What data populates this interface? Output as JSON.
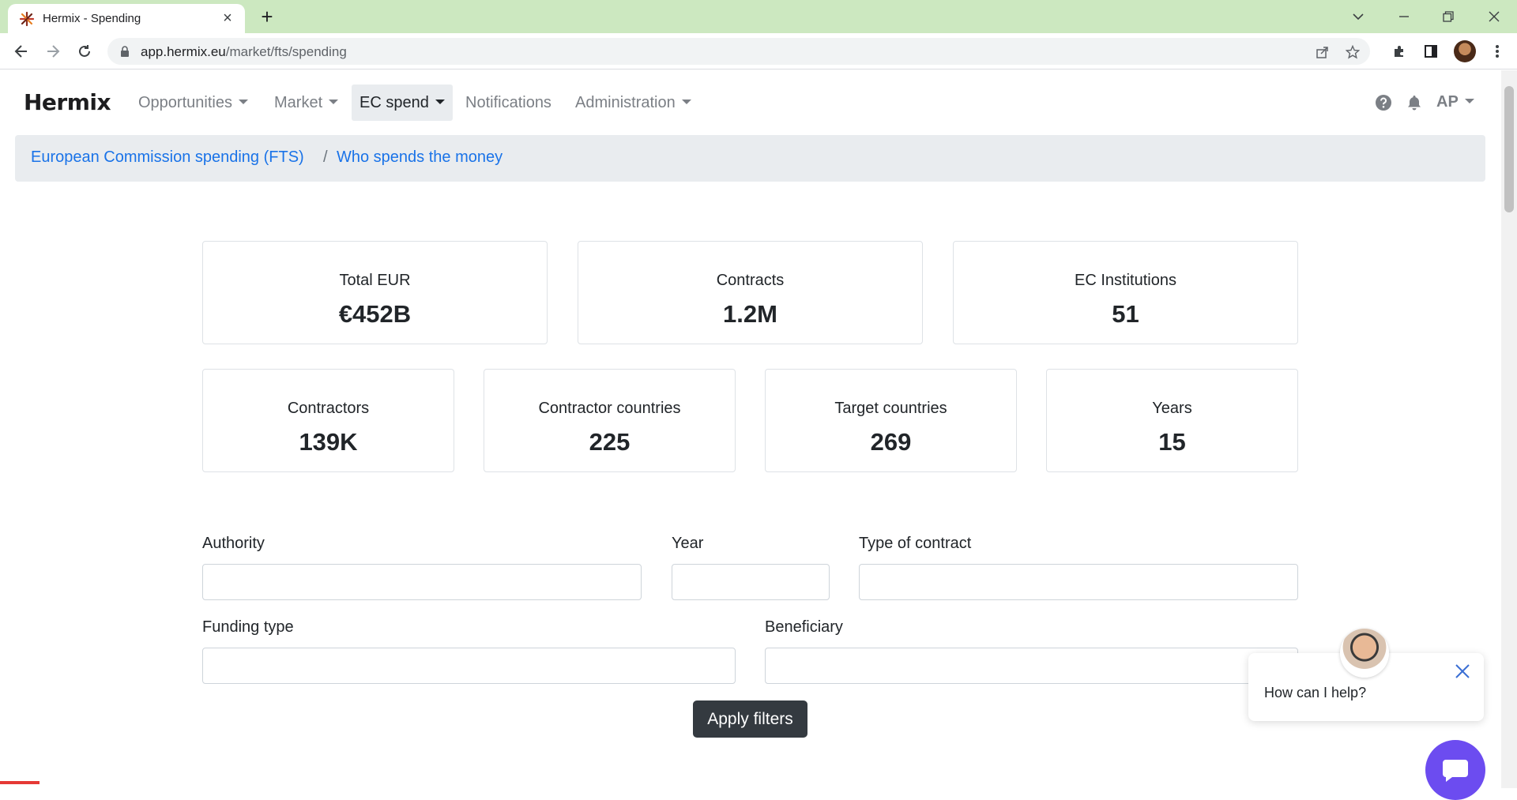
{
  "browser": {
    "tab_title": "Hermix - Spending",
    "url_host": "app.hermix.eu",
    "url_path": "/market/fts/spending"
  },
  "navbar": {
    "brand": "Hermix",
    "items": [
      {
        "label": "Opportunities"
      },
      {
        "label": "Market"
      },
      {
        "label": "EC spend"
      },
      {
        "label": "Notifications"
      },
      {
        "label": "Administration"
      }
    ],
    "user_initials": "AP"
  },
  "breadcrumb": {
    "items": [
      "European Commission spending (FTS)",
      "Who spends the money"
    ],
    "separator": "/"
  },
  "stats_row1": [
    {
      "label": "Total EUR",
      "value": "€452B"
    },
    {
      "label": "Contracts",
      "value": "1.2M"
    },
    {
      "label": "EC Institutions",
      "value": "51"
    }
  ],
  "stats_row2": [
    {
      "label": "Contractors",
      "value": "139K"
    },
    {
      "label": "Contractor countries",
      "value": "225"
    },
    {
      "label": "Target countries",
      "value": "269"
    },
    {
      "label": "Years",
      "value": "15"
    }
  ],
  "filters": {
    "authority_label": "Authority",
    "year_label": "Year",
    "contract_type_label": "Type of contract",
    "funding_type_label": "Funding type",
    "beneficiary_label": "Beneficiary",
    "authority_value": "",
    "year_value": "",
    "contract_type_value": "",
    "funding_type_value": "",
    "beneficiary_value": "",
    "apply_label": "Apply filters"
  },
  "chat": {
    "prompt": "How can I help?",
    "launcher_color": "#6c4cf0"
  },
  "colors": {
    "browser_frame": "#cce8c0",
    "link": "#1a73e8",
    "button_dark": "#343a40",
    "breadcrumb_bg": "#e9ecef"
  }
}
